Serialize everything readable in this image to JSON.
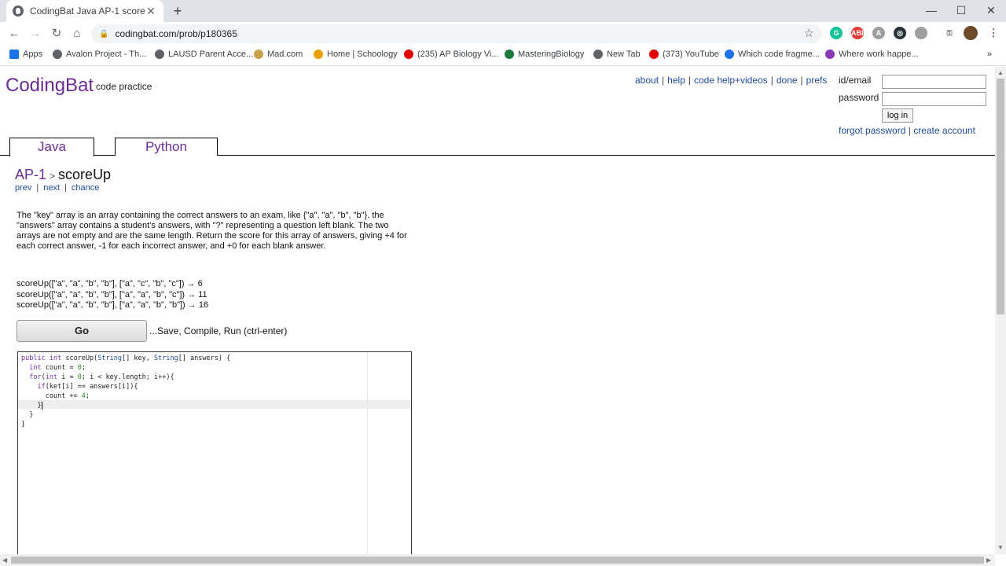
{
  "browser": {
    "tab_title": "CodingBat Java AP-1 scoreUp",
    "url": "codingbat.com/prob/p180365",
    "bookmarks": [
      {
        "label": "Apps",
        "color": "#1a73e8"
      },
      {
        "label": "Avalon Project - Th...",
        "color": "#5f6368"
      },
      {
        "label": "LAUSD Parent Acce...",
        "color": "#5f6368"
      },
      {
        "label": "Mad.com",
        "color": "#c8a24a"
      },
      {
        "label": "Home | Schoology",
        "color": "#e8a000"
      },
      {
        "label": "(235) AP Biology Vi...",
        "color": "#e00000"
      },
      {
        "label": "MasteringBiology",
        "color": "#1b7a3e"
      },
      {
        "label": "New Tab",
        "color": "#5f6368"
      },
      {
        "label": "(373) YouTube",
        "color": "#e00000"
      },
      {
        "label": "Which code fragme...",
        "color": "#1a73e8"
      },
      {
        "label": "Where work happe...",
        "color": "#8a3ab9"
      }
    ],
    "extensions": [
      {
        "name": "grammarly-icon",
        "color": "#15c39a",
        "text": "G"
      },
      {
        "name": "adblock-icon",
        "color": "#e53935",
        "text": "ABP"
      },
      {
        "name": "extension-icon",
        "color": "#9e9e9e",
        "text": "A"
      },
      {
        "name": "circle-extension-icon",
        "color": "#263238",
        "text": "◎"
      },
      {
        "name": "np-extension-icon",
        "color": "#9e9e9e",
        "text": "NP"
      },
      {
        "name": "key-icon",
        "color": "#5f6368",
        "text": "⚿"
      }
    ]
  },
  "site": {
    "logo": "CodingBat",
    "logo_sub": "code practice",
    "links": [
      "about",
      "help",
      "code help+videos",
      "done",
      "prefs"
    ],
    "login": {
      "id_label": "id/email",
      "password_label": "password",
      "button": "log in",
      "forgot": "forgot password",
      "create": "create account"
    },
    "lang_tabs": [
      "Java",
      "Python"
    ]
  },
  "problem": {
    "section": "AP-1",
    "name": "scoreUp",
    "nav": [
      "prev",
      "next",
      "chance"
    ],
    "description": "The \"key\" array is an array containing the correct answers to an exam, like {\"a\", \"a\", \"b\", \"b\"}. the \"answers\" array contains a student's answers, with \"?\" representing a question left blank. The two arrays are not empty and are the same length. Return the score for this array of answers, giving +4 for each correct answer, -1 for each incorrect answer, and +0 for each blank answer.",
    "examples": [
      "scoreUp([\"a\", \"a\", \"b\", \"b\"], [\"a\", \"c\", \"b\", \"c\"]) → 6",
      "scoreUp([\"a\", \"a\", \"b\", \"b\"], [\"a\", \"a\", \"b\", \"c\"]) → 11",
      "scoreUp([\"a\", \"a\", \"b\", \"b\"], [\"a\", \"a\", \"b\", \"b\"]) → 16"
    ],
    "go_label": "Go",
    "go_note": "...Save, Compile, Run (ctrl-enter)"
  },
  "code_lines": [
    "public int scoreUp(String[] key, String[] answers) {",
    "  int count = 0;",
    "  for(int i = 0; i < key.length; i++){",
    "    if(ket[i] == answers[i]){",
    "      count += 4;",
    "    }",
    "  }",
    "}"
  ]
}
